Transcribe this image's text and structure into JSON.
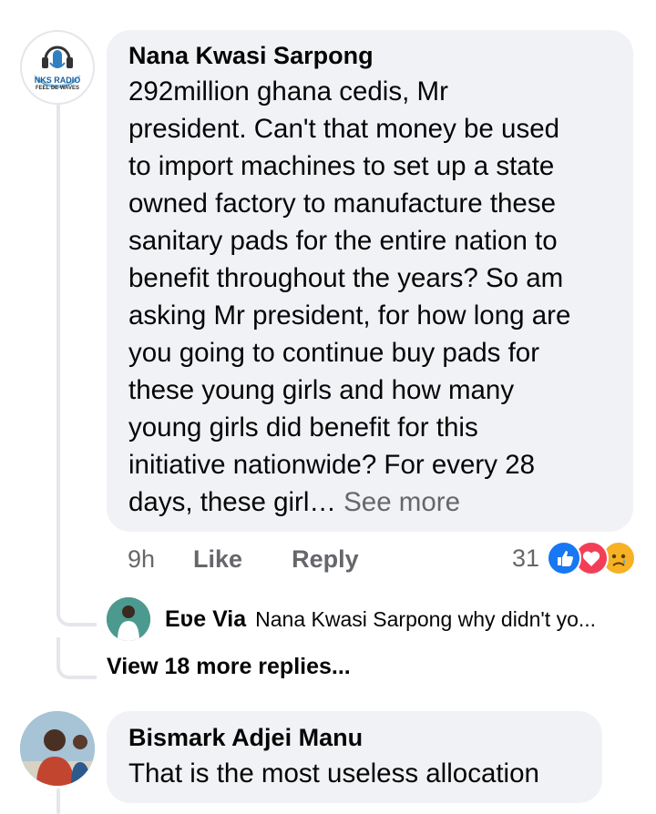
{
  "comment": {
    "author": "Nana Kwasi Sarpong",
    "avatar_text": "NKS RADIO",
    "avatar_tagline": "FEEL DE WAVES",
    "text_lines": [
      "292million ghana cedis, Mr",
      "president.  Can't that money be used",
      "to import machines to set up a state",
      "owned factory to manufacture these",
      "sanitary pads for the entire nation to",
      "benefit throughout the years? So am",
      "asking Mr president, for how long are",
      "you going to continue buy pads for",
      "these young girls and how many",
      "young girls did benefit for this",
      "initiative nationwide? For every 28"
    ],
    "last_line": "days, these girl…",
    "see_more": "See more",
    "time": "9h",
    "like_label": "Like",
    "reply_label": "Reply",
    "reaction_count": "31",
    "reaction_icons": [
      "like-icon",
      "love-icon",
      "sad-icon"
    ]
  },
  "reply_preview": {
    "author": "Eʋe Via",
    "text": "Nana Kwasi Sarpong why didn't yo..."
  },
  "view_more_replies": "View 18 more replies...",
  "comment2": {
    "author": "Bismark Adjei Manu",
    "text": "That is the most useless allocation"
  },
  "colors": {
    "bubble": "#f0f2f5",
    "secondary_text": "#65676b",
    "thread_line": "#e4e6eb",
    "like_blue": "#1877f2",
    "love_red": "#f33e58",
    "sad_yellow": "#f7b125"
  }
}
